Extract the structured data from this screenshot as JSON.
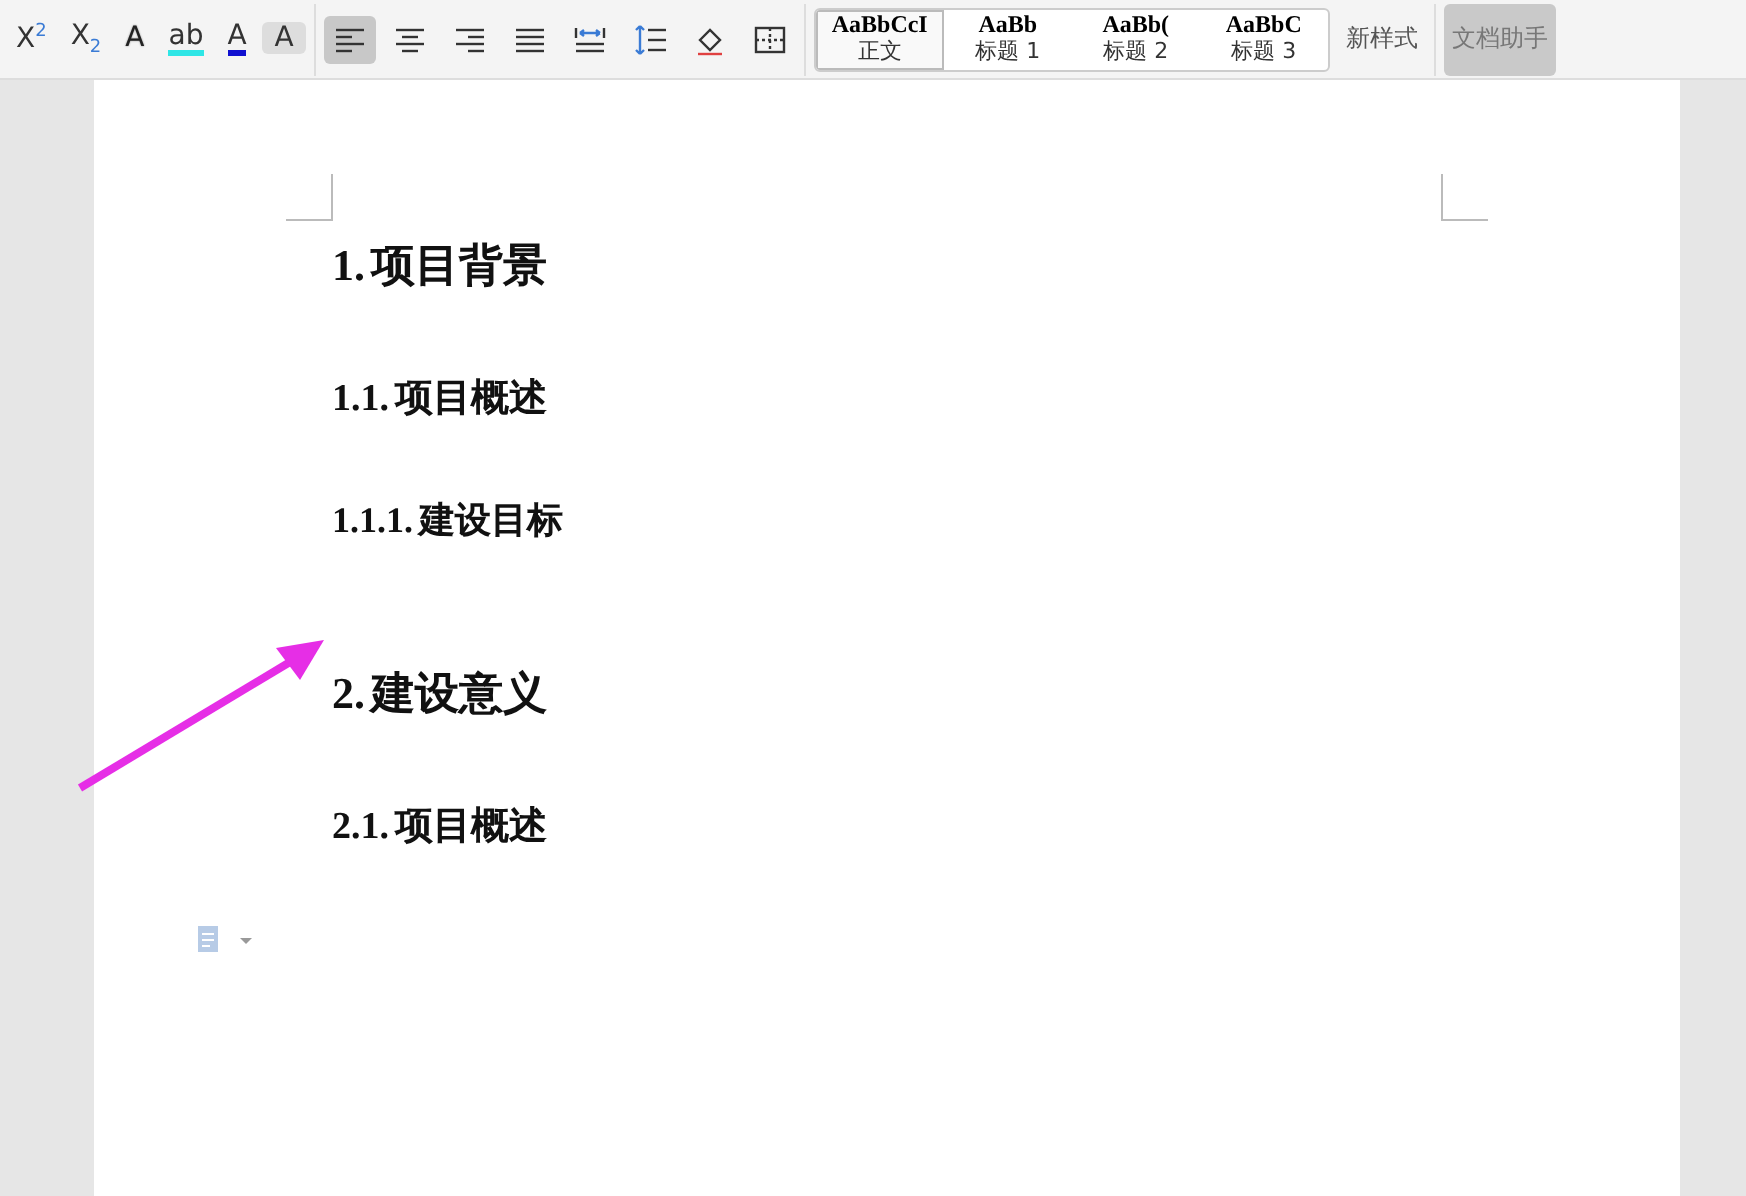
{
  "toolbar": {
    "font_buttons": [
      {
        "kind": "sup",
        "label": "X",
        "mark": "2"
      },
      {
        "kind": "sub",
        "label": "X",
        "mark": "2"
      },
      {
        "kind": "outline",
        "label": "A"
      },
      {
        "kind": "highlight",
        "label": "ab"
      },
      {
        "kind": "color",
        "label": "A"
      },
      {
        "kind": "shade",
        "label": "A"
      }
    ],
    "paragraph_buttons": [
      {
        "kind": "align-left",
        "selected": true
      },
      {
        "kind": "align-center",
        "selected": false
      },
      {
        "kind": "align-right",
        "selected": false
      },
      {
        "kind": "justify",
        "selected": false
      },
      {
        "kind": "distribute",
        "selected": false
      },
      {
        "kind": "spacing",
        "selected": false
      },
      {
        "kind": "fill",
        "selected": false
      },
      {
        "kind": "border",
        "selected": false
      }
    ],
    "styles": [
      {
        "preview": "AaBbCcI",
        "label": "正文",
        "selected": true
      },
      {
        "preview": "AaBb",
        "label": "标题 1",
        "selected": false
      },
      {
        "preview": "AaBb(",
        "label": "标题 2",
        "selected": false
      },
      {
        "preview": "AaBbC",
        "label": "标题 3",
        "selected": false
      }
    ],
    "new_style": "新样式",
    "assistant": "文档助手"
  },
  "document": {
    "headings": [
      {
        "kind": "h1",
        "number": "1.",
        "text": "项目背景"
      },
      {
        "kind": "h2",
        "number": "1.1.",
        "text": "项目概述"
      },
      {
        "kind": "h3",
        "number": "1.1.1.",
        "text": "建设目标"
      },
      {
        "kind": "h1",
        "number": "2.",
        "text": "建设意义"
      },
      {
        "kind": "h2",
        "number": "2.1.",
        "text": "项目概述"
      }
    ]
  }
}
